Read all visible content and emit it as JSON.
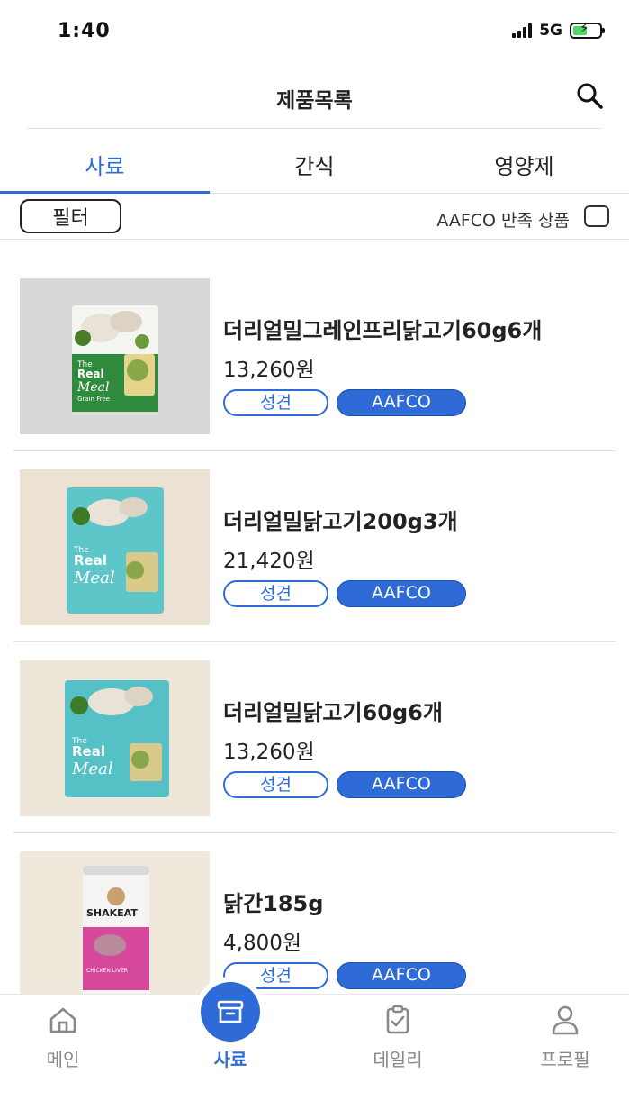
{
  "status_bar": {
    "time": "1:40",
    "network": "5G",
    "battery": 0.55
  },
  "header": {
    "title": "제품목록",
    "search_icon": "search-icon"
  },
  "tabs": [
    {
      "label": "사료",
      "active": true
    },
    {
      "label": "간식",
      "active": false
    },
    {
      "label": "영양제",
      "active": false
    }
  ],
  "filter": {
    "button_label": "필터",
    "aafco_label": "AAFCO 만족 상품",
    "aafco_checked": false
  },
  "products": [
    {
      "name": "더리얼밀그레인프리닭고기60g6개",
      "price": "13,260원",
      "tags": [
        "성견",
        "AAFCO"
      ]
    },
    {
      "name": "더리얼밀닭고기200g3개",
      "price": "21,420원",
      "tags": [
        "성견",
        "AAFCO"
      ]
    },
    {
      "name": "더리얼밀닭고기60g6개",
      "price": "13,260원",
      "tags": [
        "성견",
        "AAFCO"
      ]
    },
    {
      "name": "닭간185g",
      "price": "4,800원",
      "tags": [
        "성견",
        "AAFCO"
      ]
    }
  ],
  "thumb_text": [
    {
      "brand": "The",
      "line1": "Real",
      "line2": "Meal",
      "line3": "Grain Free"
    },
    {
      "brand": "The",
      "line1": "Real",
      "line2": "Meal",
      "line3": ""
    },
    {
      "brand": "The",
      "line1": "Real",
      "line2": "Meal",
      "line3": ""
    },
    {
      "brand": "SHAKEAT",
      "line1": "CHICKEN LIVER",
      "line2": "",
      "line3": ""
    }
  ],
  "bottom_nav": [
    {
      "label": "메인",
      "icon": "home-icon",
      "active": false
    },
    {
      "label": "사료",
      "icon": "archive-box-icon",
      "active": true
    },
    {
      "label": "데일리",
      "icon": "clipboard-check-icon",
      "active": false
    },
    {
      "label": "프로필",
      "icon": "user-icon",
      "active": false
    }
  ],
  "colors": {
    "accent": "#2e6bd6",
    "text": "#222222",
    "muted": "#888888"
  }
}
